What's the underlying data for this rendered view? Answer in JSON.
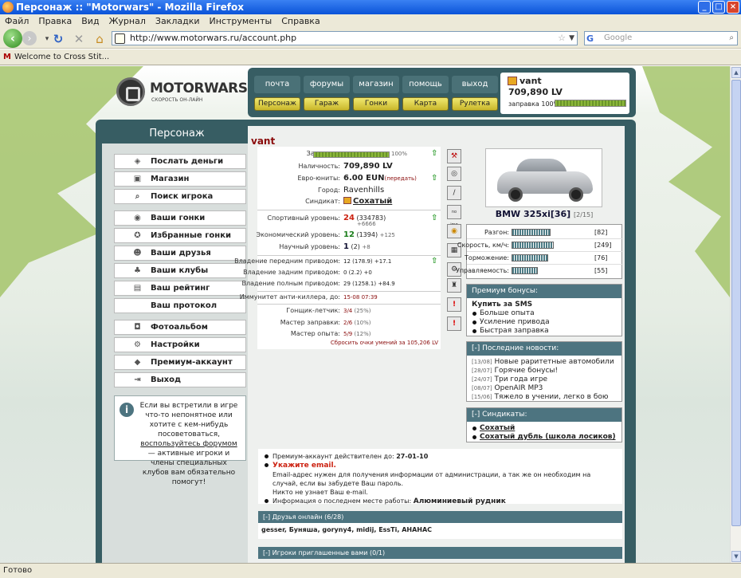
{
  "browser": {
    "title": "Персонаж :: \"Motorwars\" - Mozilla Firefox",
    "menu": [
      "Файл",
      "Правка",
      "Вид",
      "Журнал",
      "Закладки",
      "Инструменты",
      "Справка"
    ],
    "url": "http://www.motorwars.ru/account.php",
    "search_placeholder": "Google",
    "bookmark": "Welcome to Cross Stit...",
    "status": "Готово"
  },
  "site": {
    "logo_name": "MOTORWARS.RU",
    "logo_tagline": "СКОРОСТЬ ОН-ЛАЙН",
    "topnav": [
      "почта",
      "форумы",
      "магазин",
      "помощь",
      "выход"
    ],
    "subnav": [
      "Персонаж",
      "Гараж",
      "Гонки",
      "Карта",
      "Рулетка"
    ],
    "user": {
      "name": "vant",
      "cash": "709,890 LV",
      "fuel_label": "заправка 100%",
      "fuel_level": 100
    }
  },
  "left": {
    "title": "Персонаж",
    "menu": [
      {
        "label": "Послать деньги",
        "icon": "money-icon"
      },
      {
        "label": "Магазин",
        "icon": "shop-icon"
      },
      {
        "label": "Поиск игрока",
        "icon": "search-icon"
      },
      {
        "label": "Ваши гонки",
        "icon": "race-icon"
      },
      {
        "label": "Избранные гонки",
        "icon": "favorite-race-icon"
      },
      {
        "label": "Ваши друзья",
        "icon": "friends-icon"
      },
      {
        "label": "Ваши клубы",
        "icon": "clubs-icon"
      },
      {
        "label": "Ваш рейтинг",
        "icon": "rating-icon"
      },
      {
        "label": "Ваш протокол",
        "icon": ""
      },
      {
        "label": "Фотоальбом",
        "icon": "camera-icon"
      },
      {
        "label": "Настройки",
        "icon": "settings-icon"
      },
      {
        "label": "Премиум-аккаунт",
        "icon": "premium-icon"
      },
      {
        "label": "Выход",
        "icon": "exit-icon"
      }
    ],
    "help": {
      "text1": "Если вы встретили в игре что-то непонятное или хотите с кем-нибудь посоветоваться,",
      "link": "воспользуйтесь форумом",
      "text2": " — активные игроки и члены специальных клубов вам обязательно помогут!"
    }
  },
  "profile": {
    "name": "vant",
    "stats": {
      "fuel_k": "Заправка:",
      "fuel_v": "100%",
      "cash_k": "Наличность:",
      "cash_v": "709,890 LV",
      "euro_k": "Евро-юниты:",
      "euro_v": "6.00 EUN",
      "euro_link": "(передать)",
      "city_k": "Город:",
      "city_v": "Ravenhills",
      "synd_k": "Синдикат:",
      "synd_v": "Сохатый",
      "sport_k": "Спортивный уровень:",
      "sport_v": "24",
      "sport_x": "(334783)",
      "sport_d": "+6666",
      "econ_k": "Экономический уровень:",
      "econ_v": "12",
      "econ_x": "(1394)",
      "econ_d": "+125",
      "sci_k": "Научный уровень:",
      "sci_v": "1",
      "sci_x": "(2)",
      "sci_d": "+8",
      "fwd_k": "Владение передним приводом:",
      "fwd_v": "12 (178.9) +17.1",
      "rwd_k": "Владение задним приводом:",
      "rwd_v": "0 (2.2) +0",
      "awd_k": "Владение полным приводом:",
      "awd_v": "29 (1258.1) +84.9",
      "imm_k": "Иммунитет анти-киллера, до:",
      "imm_v": "15-08 07:39",
      "racer_k": "Гонщик-летчик:",
      "racer_v": "3/4",
      "racer_p": "(25%)",
      "fill_k": "Мастер заправки:",
      "fill_v": "2/6",
      "fill_p": "(10%)",
      "exp_k": "Мастер опыта:",
      "exp_v": "5/9",
      "exp_p": "(12%)",
      "reset": "Сбросить очки умений за 105,206 LV"
    }
  },
  "car": {
    "name": "BMW 325xi[36]",
    "count": "[2/15]",
    "stats": [
      {
        "k": "Разгон:",
        "v": "[82]",
        "lvl": 0.82
      },
      {
        "k": "Скорость, км/ч:",
        "v": "[249]",
        "lvl": 0.88
      },
      {
        "k": "Торможение:",
        "v": "[76]",
        "lvl": 0.76
      },
      {
        "k": "Управляемость:",
        "v": "[55]",
        "lvl": 0.55
      }
    ]
  },
  "bonus": {
    "title": "Премиум бонусы:",
    "head": "Купить за SMS",
    "items": [
      "Больше опыта",
      "Усиление привода",
      "Быстрая заправка"
    ]
  },
  "news": {
    "title": "[-]  Последние новости:",
    "items": [
      {
        "d": "[13/08]",
        "t": "Новые раритетные автомобили"
      },
      {
        "d": "[28/07]",
        "t": "Горячие бонусы!"
      },
      {
        "d": "[24/07]",
        "t": "Три года игре"
      },
      {
        "d": "[08/07]",
        "t": "OpenAIR MP3"
      },
      {
        "d": "[15/06]",
        "t": "Тяжело в учении, легко в бою"
      }
    ]
  },
  "synd": {
    "title": "[-]  Синдикаты:",
    "items": [
      "Сохатый",
      "Сохатый дубль (школа лосиков)"
    ]
  },
  "premium": {
    "l1": "Премиум-аккаунт действителен до: ",
    "l1v": "27-01-10",
    "l2": "Укажите email.",
    "l3": "Email-адрес нужен для получения информации от администрации, а так же он необходим на случай, если вы забудете Ваш пароль.",
    "l4": "Никто не узнает Ваш e-mail.",
    "l5": "Информация о последнем месте работы: ",
    "l5v": "Алюминиевый рудник"
  },
  "friends": {
    "title": "[-]  Друзья онлайн (6/28)",
    "list": "gesser, Буняша, gorуny4, midij, EssTi, AHAHAC"
  },
  "invited": {
    "title": "[-]  Игроки приглашенные вами (0/1)"
  }
}
